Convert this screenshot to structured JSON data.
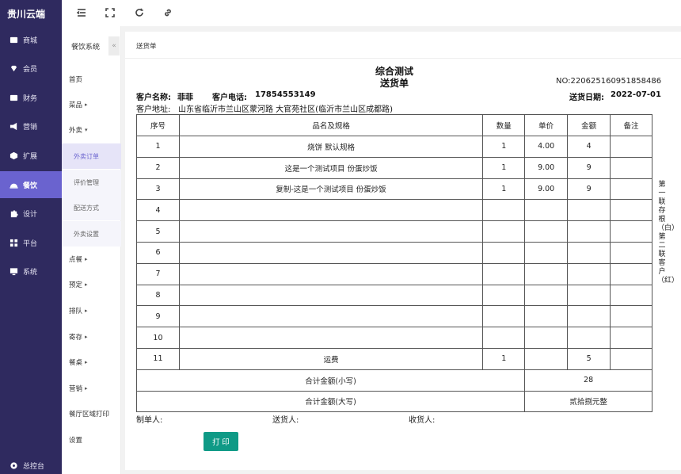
{
  "brand": "贵川云端",
  "nav": [
    {
      "label": "商城",
      "icon": "store-icon"
    },
    {
      "label": "会员",
      "icon": "diamond-icon"
    },
    {
      "label": "财务",
      "icon": "wallet-icon"
    },
    {
      "label": "营销",
      "icon": "megaphone-icon"
    },
    {
      "label": "扩展",
      "icon": "box-icon"
    },
    {
      "label": "餐饮",
      "icon": "cloche-icon"
    },
    {
      "label": "设计",
      "icon": "puzzle-icon"
    },
    {
      "label": "平台",
      "icon": "grid-icon"
    },
    {
      "label": "系统",
      "icon": "monitor-icon"
    }
  ],
  "dashboard": "总控台",
  "subnav": {
    "title": "餐饮系统",
    "collapse": "«",
    "items": [
      "首页",
      "菜品",
      "外卖",
      "外卖订单",
      "评价管理",
      "配送方式",
      "外卖设置",
      "点餐",
      "预定",
      "排队",
      "寄存",
      "餐桌",
      "营销",
      "餐厅区域打印",
      "设置"
    ]
  },
  "breadcrumb": "送货单",
  "doc": {
    "title": "综合测试",
    "subtitle": "送货单",
    "no": "NO:220625160951858486",
    "customer_name_label": "客户名称:",
    "customer_name": "菲菲",
    "customer_phone_label": "客户电话:",
    "customer_phone": "17854553149",
    "date_label": "送货日期:",
    "date": "2022-07-01",
    "address_label": "客户地址:",
    "address": "山东省临沂市兰山区蒙河路 大官苑社区(临沂市兰山区成都路)",
    "headers": [
      "序号",
      "品名及规格",
      "数量",
      "单价",
      "金额",
      "备注"
    ],
    "rows": [
      [
        "1",
        "烧饼 默认规格",
        "1",
        "4.00",
        "4",
        ""
      ],
      [
        "2",
        "这是一个测试项目 份蛋炒饭",
        "1",
        "9.00",
        "9",
        ""
      ],
      [
        "3",
        "复制-这是一个测试项目 份蛋炒饭",
        "1",
        "9.00",
        "9",
        ""
      ],
      [
        "4",
        "",
        "",
        "",
        "",
        ""
      ],
      [
        "5",
        "",
        "",
        "",
        "",
        ""
      ],
      [
        "6",
        "",
        "",
        "",
        "",
        ""
      ],
      [
        "7",
        "",
        "",
        "",
        "",
        ""
      ],
      [
        "8",
        "",
        "",
        "",
        "",
        ""
      ],
      [
        "9",
        "",
        "",
        "",
        "",
        ""
      ],
      [
        "10",
        "",
        "",
        "",
        "",
        ""
      ],
      [
        "11",
        "运费",
        "1",
        "",
        "5",
        ""
      ]
    ],
    "total_small_label": "合计金额(小写)",
    "total_small": "28",
    "total_big_label": "合计金额(大写)",
    "total_big": "贰拾捌元整",
    "side_note": "第一联存根（白）第二联客户（红）",
    "maker_label": "制单人:",
    "deliverer_label": "送货人:",
    "receiver_label": "收货人:",
    "print_label": "打 印"
  }
}
